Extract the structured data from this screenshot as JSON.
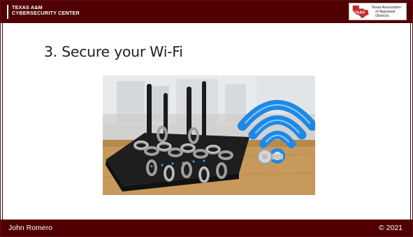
{
  "header": {
    "left_logo_lines": [
      "TEXAS A&M",
      "CYBERSECURITY CENTER"
    ],
    "right_logo_text": {
      "line1": "Texas Association",
      "line2": "of Appraisal Districts",
      "mark_text": "TAAD"
    }
  },
  "slide": {
    "title": "3. Secure your Wi-Fi",
    "image": {
      "type": "illustration",
      "description_icon": "wifi-router-locked-icon"
    }
  },
  "footer": {
    "author": "John Romero",
    "copyright": "© 2021"
  },
  "colors": {
    "maroon": "#500000",
    "wifi_blue": "#1e88e5"
  }
}
